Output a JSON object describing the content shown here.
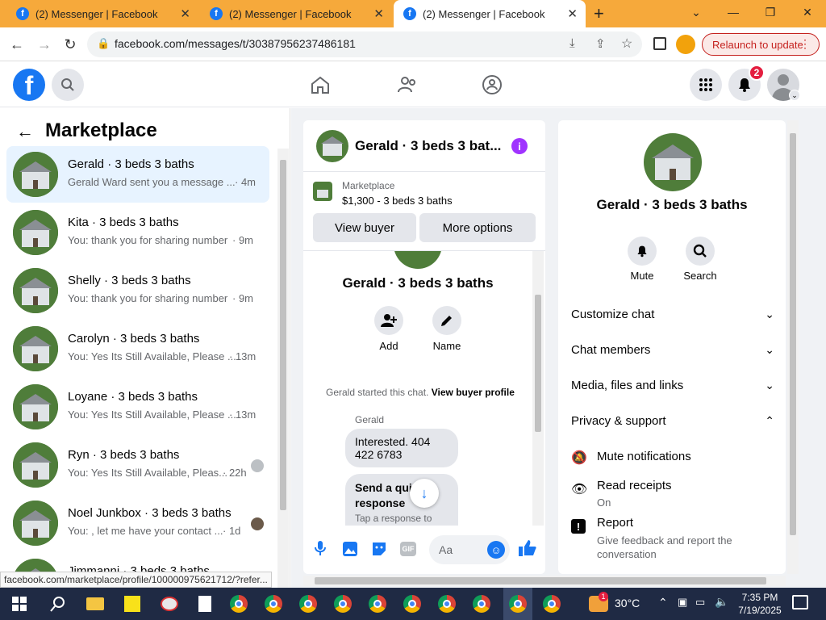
{
  "browser": {
    "tabs": [
      {
        "title": "(2) Messenger | Facebook"
      },
      {
        "title": "(2) Messenger | Facebook"
      },
      {
        "title": "(2) Messenger | Facebook"
      }
    ],
    "url": "facebook.com/messages/t/30387956237486181",
    "relaunch_label": "Relaunch to update",
    "status_url": "facebook.com/marketplace/profile/100000975621712/?refer..."
  },
  "header": {
    "notification_count": "2"
  },
  "left": {
    "title": "Marketplace",
    "conversations": [
      {
        "title": "Gerald · 3 beds 3 baths",
        "snippet": "Gerald Ward sent you a message ...",
        "time": "· 4m"
      },
      {
        "title": "Kita · 3 beds 3 baths",
        "snippet": "You: thank you for sharing number",
        "time": "· 9m"
      },
      {
        "title": "Shelly · 3 beds 3 baths",
        "snippet": "You: thank you for sharing number",
        "time": "· 9m"
      },
      {
        "title": "Carolyn · 3 beds 3 baths",
        "snippet": "You: Yes Its Still Available, Please ...",
        "time": "· 13m"
      },
      {
        "title": "Loyane · 3 beds 3 baths",
        "snippet": "You: Yes Its Still Available, Please ...",
        "time": "· 13m"
      },
      {
        "title": "Ryn · 3 beds 3 baths",
        "snippet": "You: Yes Its Still Available, Pleas...",
        "time": "· 22h"
      },
      {
        "title": "Noel Junkbox · 3 beds 3 baths",
        "snippet": "You: , let me have your contact ...",
        "time": "· 1d"
      },
      {
        "title": "Jimmanni · 3 beds 3 baths",
        "snippet": "",
        "time": ""
      }
    ]
  },
  "chat": {
    "title": "Gerald · 3 beds 3 bat...",
    "listing_source": "Marketplace",
    "listing_detail": "$1,300 - 3 beds 3 baths",
    "view_buyer": "View buyer",
    "more_options": "More options",
    "profile_name": "Gerald · 3 beds 3 baths",
    "add_label": "Add",
    "name_label": "Name",
    "started_text": "Gerald started this chat.",
    "view_profile_link": "View buyer profile",
    "sender": "Gerald",
    "message1": "Interested.  404 422 6783",
    "quick_reply_title": "Send a qui... response",
    "quick_reply_sub": "Tap a response to",
    "input_placeholder": "Aa"
  },
  "info": {
    "name": "Gerald · 3 beds 3 baths",
    "mute_label": "Mute",
    "search_label": "Search",
    "sections": [
      "Customize chat",
      "Chat members",
      "Media, files and links",
      "Privacy & support"
    ],
    "mute_notifications": "Mute notifications",
    "read_receipts": "Read receipts",
    "read_receipts_status": "On",
    "report": "Report",
    "report_sub": "Give feedback and report the conversation"
  },
  "taskbar": {
    "temperature": "30°C",
    "weather_badge": "1",
    "time": "7:35 PM",
    "date": "7/19/2025"
  },
  "colors": {
    "brand": "#1877f2",
    "titlebar": "#f6a93b",
    "accent_purple": "#a033ff",
    "badge_red": "#e41e3f"
  }
}
